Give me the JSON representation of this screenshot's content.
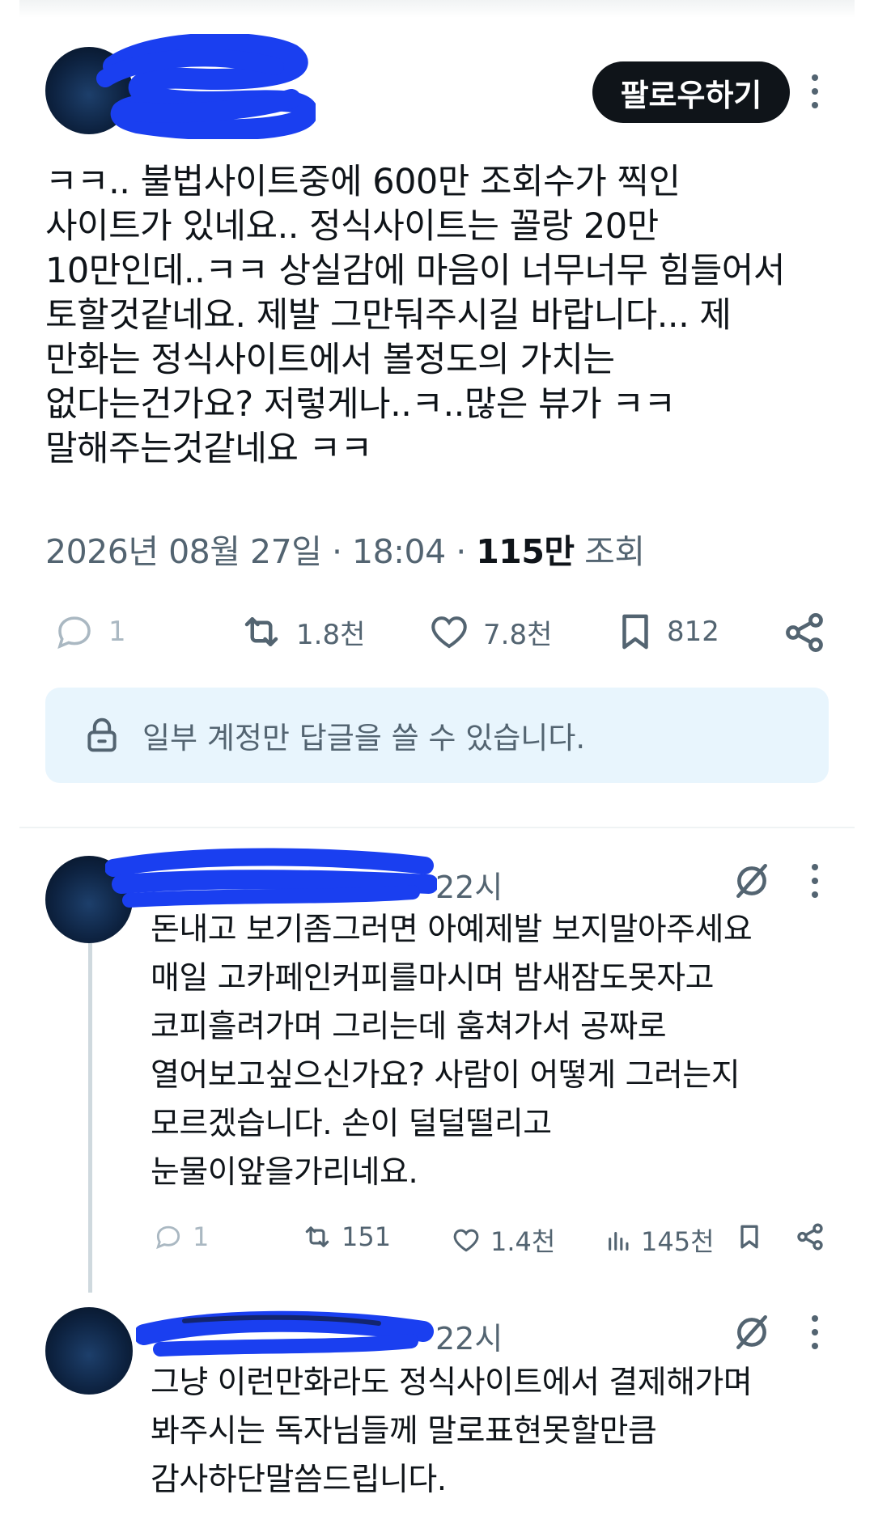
{
  "post": {
    "follow_label": "팔로우하기",
    "text": "ㅋㅋ.. 불법사이트중에 600만 조회수가 찍인\n사이트가 있네요.. 정식사이트는 꼴랑 20만\n10만인데..ㅋㅋ 상실감에 마음이 너무너무 힘들어서\n토할것같네요. 제발 그만둬주시길 바랍니다... 제\n만화는 정식사이트에서 볼정도의 가치는\n없다는건가요? 저렇게나..ㅋ..많은 뷰가 ㅋㅋ\n말해주는것같네요 ㅋㅋ",
    "date": "2026년 08월 27일 · 18:04 · ",
    "views": "115만",
    "views_label": " 조회",
    "actions": {
      "replies": "1",
      "reposts": "1.8천",
      "likes": "7.8천",
      "bookmarks": "812"
    },
    "reply_restriction": "일부 계정만 답글을 쓸 수 있습니다."
  },
  "comments": [
    {
      "time": "22시",
      "text": "돈내고 보기좀그러면 아예제발 보지말아주세요\n매일 고카페인커피를마시며 밤새잠도못자고\n코피흘려가며 그리는데 훔쳐가서 공짜로\n열어보고싶으신가요? 사람이 어떻게 그러는지\n모르겠습니다. 손이 덜덜떨리고\n눈물이앞을가리네요.",
      "actions": {
        "replies": "1",
        "reposts": "151",
        "likes": "1.4천",
        "views": "145천"
      }
    },
    {
      "time": "22시",
      "text": "그냥 이런만화라도 정식사이트에서 결제해가며\n봐주시는 독자님들께 말로표현못할만큼\n감사하단말씀드립니다."
    }
  ],
  "colors": {
    "text": "#0f1419",
    "secondary": "#536471",
    "reply_box_bg": "#e8f5fd",
    "redaction": "#1a3ff0"
  },
  "icons": [
    "reply-icon",
    "repost-icon",
    "like-icon",
    "bookmark-icon",
    "share-icon",
    "lock-icon",
    "grok-icon",
    "views-icon",
    "more-icon"
  ]
}
